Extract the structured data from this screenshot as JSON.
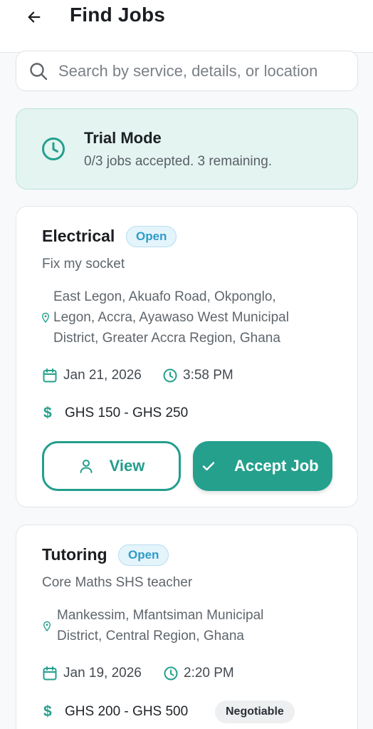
{
  "header": {
    "title": "Find Jobs",
    "back_icon": "arrow-left-icon"
  },
  "search": {
    "placeholder": "Search by service, details, or location",
    "icon": "search-icon"
  },
  "trial": {
    "title": "Trial Mode",
    "subtitle": "0/3 jobs accepted. 3 remaining.",
    "icon": "clock-icon"
  },
  "jobs": [
    {
      "category": "Electrical",
      "status": "Open",
      "description": "Fix my socket",
      "location_lines": [
        "East Legon, Akuafo Road, Okponglo,",
        "Legon, Accra, Ayawaso West Municipal",
        "District, Greater Accra Region, Ghana"
      ],
      "date": "Jan 21, 2026",
      "time": "3:58 PM",
      "price": "GHS 150 - GHS 250",
      "currency_symbol": "$",
      "view_label": "View",
      "accept_label": "Accept Job"
    },
    {
      "category": "Tutoring",
      "status": "Open",
      "description": "Core Maths SHS teacher",
      "location_lines": [
        "Mankessim, Mfantsiman Municipal",
        "District, Central Region, Ghana"
      ],
      "date": "Jan 19, 2026",
      "time": "2:20 PM",
      "price": "GHS 200 - GHS 500",
      "currency_symbol": "$",
      "negotiable": "Negotiable"
    }
  ],
  "colors": {
    "accent": "#25a08d",
    "trial_bg": "#e4f4f1",
    "badge_text": "#2f9cc8"
  }
}
